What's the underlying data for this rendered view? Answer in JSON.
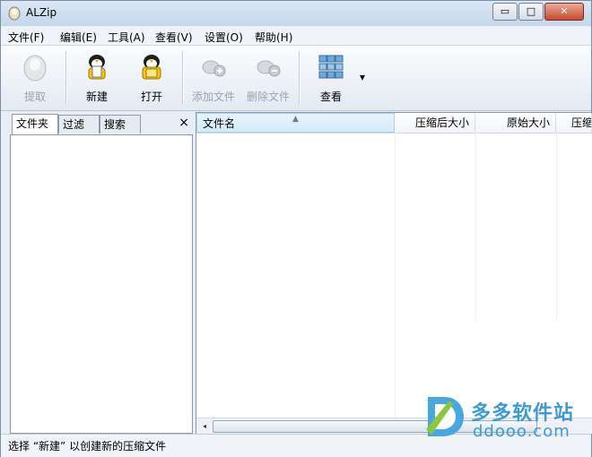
{
  "window": {
    "title": "ALZip",
    "minimize": "▭",
    "maximize": "□",
    "close": "✕"
  },
  "menu": [
    "文件(F)",
    "编辑(E)",
    "工具(A)",
    "查看(V)",
    "设置(O)",
    "帮助(H)"
  ],
  "toolbar": {
    "extract": "提取",
    "new": "新建",
    "open": "打开",
    "add_file": "添加文件",
    "delete_file": "删除文件",
    "view": "查看",
    "view_dropdown": "▾"
  },
  "left_tabs": {
    "folder": "文件夹",
    "filter": "过滤",
    "search": "搜索",
    "close": "×"
  },
  "columns": {
    "name": "文件名",
    "compressed_size": "压缩后大小",
    "original_size": "原始大小",
    "ratio": "压缩"
  },
  "scroll": {
    "left": "◂",
    "right": "▸"
  },
  "status": "选择 “新建” 以创建新的压缩文件",
  "watermark": {
    "cn": "多多软件站",
    "en": "ddooo.com"
  },
  "colors": {
    "accent": "#3e9ad6",
    "title_bg": "#c4d6ea",
    "close_btn": "#c94a2f"
  }
}
